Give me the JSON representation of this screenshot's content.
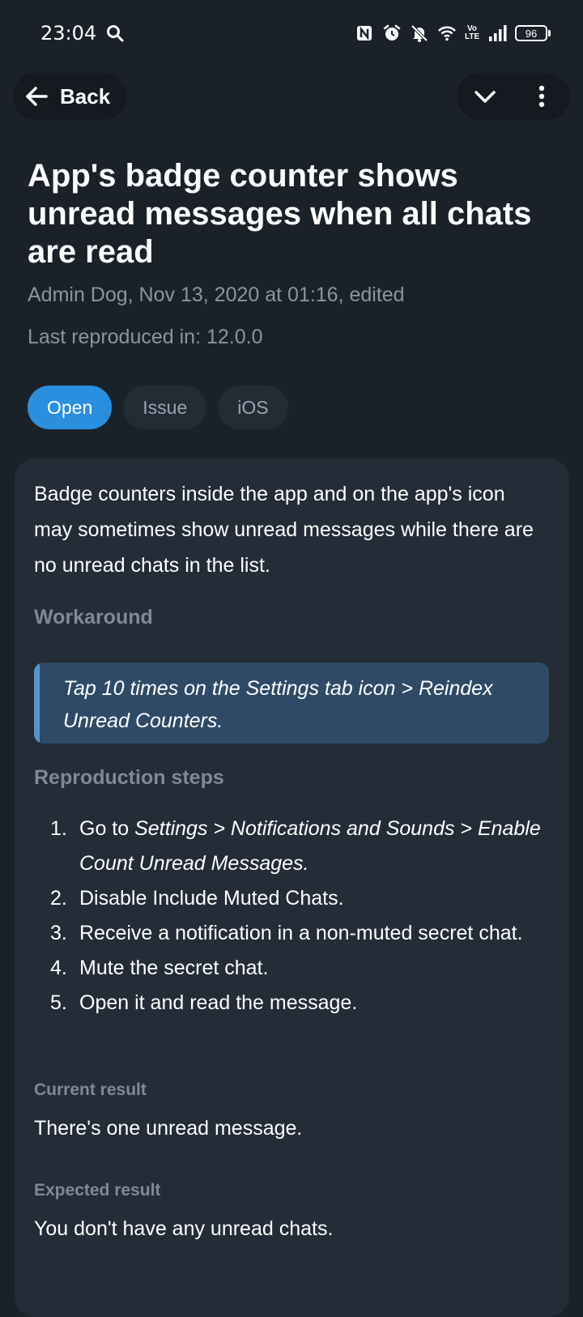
{
  "status_bar": {
    "time": "23:04",
    "icons": [
      "search-icon",
      "nfc-icon",
      "alarm-icon",
      "bell-muted-icon",
      "wifi-icon",
      "volte-icon",
      "signal-icon",
      "battery-icon"
    ],
    "volte_line1": "Vo",
    "volte_line2": "LTE",
    "battery_level": "96"
  },
  "nav": {
    "back_label": "Back",
    "icons": [
      "back-arrow-icon",
      "chevron-down-icon",
      "more-vertical-icon"
    ]
  },
  "issue": {
    "title": "App's badge counter shows unread messages when all chats are read",
    "meta": "Admin Dog, Nov 13, 2020 at 01:16, edited",
    "last_reproduced": "Last reproduced in:  12.0.0",
    "tags": [
      "Open",
      "Issue",
      "iOS"
    ],
    "description": "Badge counters inside the app and on the app's icon may sometimes show unread messages while there are no unread chats in the list.",
    "workaround_heading": "Workaround",
    "workaround_text": "Tap 10 times on the Settings tab icon > Reindex Unread Counters.",
    "steps_heading": "Reproduction steps",
    "steps": [
      {
        "num": "1.",
        "prefix": "Go to ",
        "italic": "Settings > Notifications and Sounds > Enable Count Unread Messages.",
        "suffix": ""
      },
      {
        "num": "2.",
        "prefix": "Disable Include Muted Chats.",
        "italic": "",
        "suffix": ""
      },
      {
        "num": "3.",
        "prefix": "Receive a notification in a non-muted secret chat.",
        "italic": "",
        "suffix": ""
      },
      {
        "num": "4.",
        "prefix": "Mute the secret chat.",
        "italic": "",
        "suffix": ""
      },
      {
        "num": "5.",
        "prefix": "Open it and read the message.",
        "italic": "",
        "suffix": ""
      }
    ],
    "current_heading": "Current result",
    "current_text": "There's one unread message.",
    "expected_heading": "Expected result",
    "expected_text": "You don't have any unread chats."
  },
  "colors": {
    "background": "#1b2129",
    "card": "#232c37",
    "accent": "#2b8fe0",
    "quote_bg": "#2e4a66",
    "muted_text": "#8a95a2"
  }
}
